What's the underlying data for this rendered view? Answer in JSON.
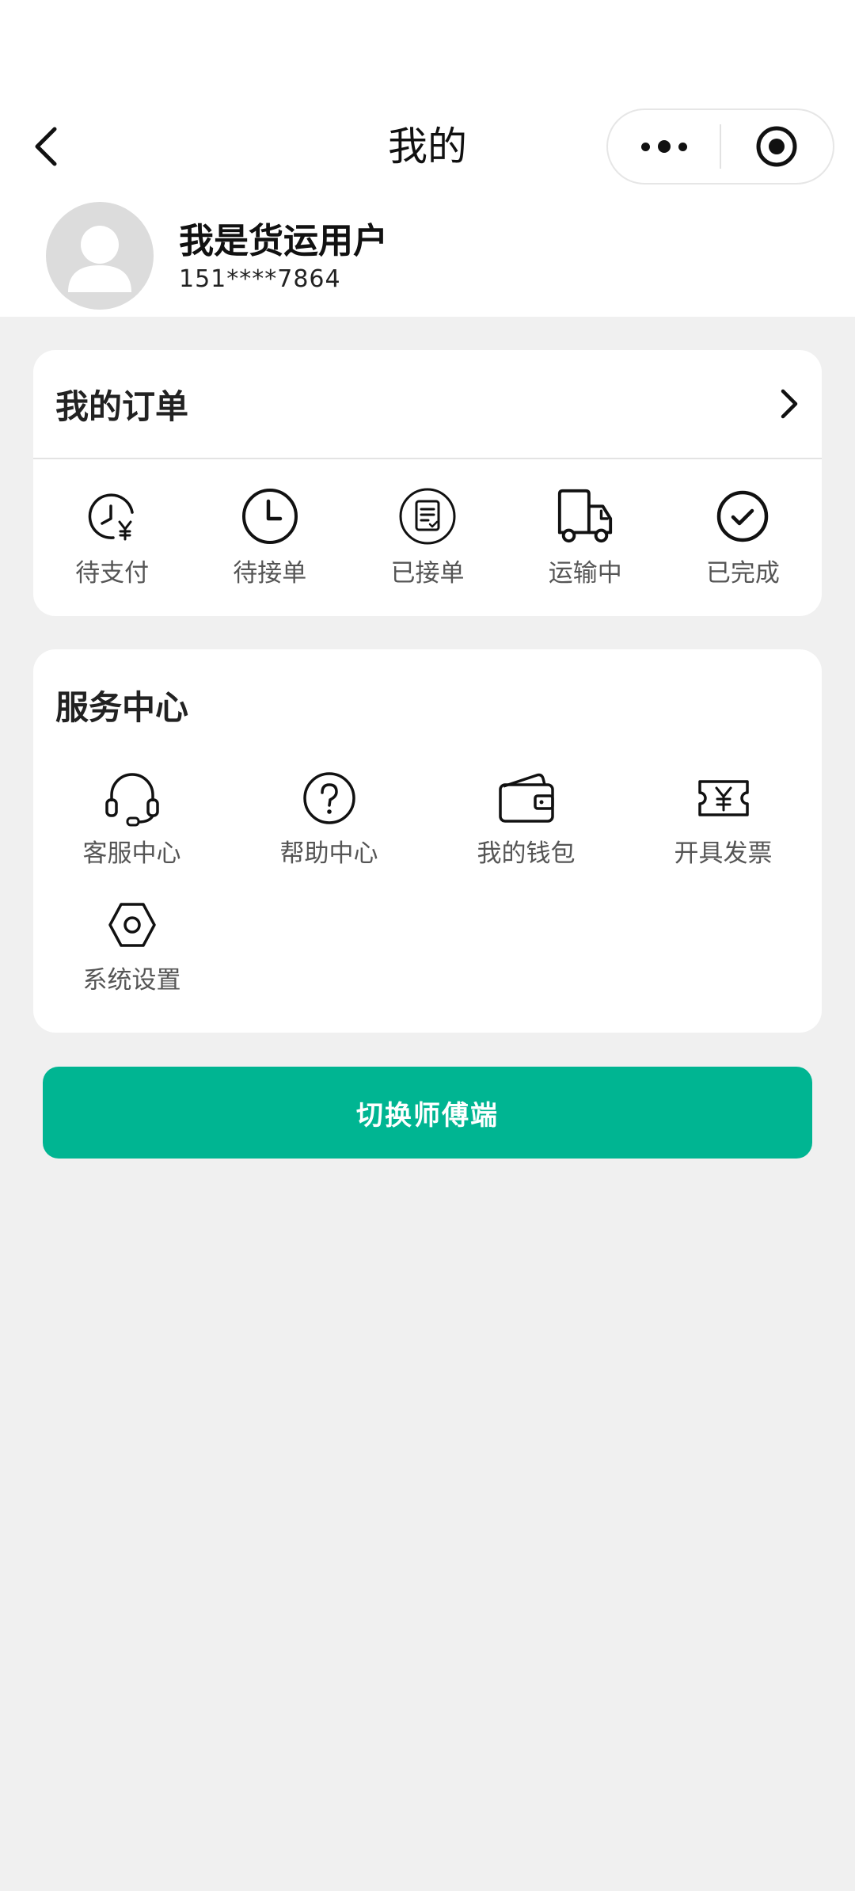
{
  "header": {
    "title": "我的",
    "back_icon": "chevron-left-icon",
    "menu_icon": "more-dots-icon",
    "close_icon": "target-circle-icon"
  },
  "user": {
    "name": "我是货运用户",
    "phone": "151****7864",
    "avatar_icon": "default-avatar-icon"
  },
  "orders": {
    "title": "我的订单",
    "chevron_icon": "chevron-right-icon",
    "items": [
      {
        "label": "待支付",
        "icon": "clock-yuan-icon"
      },
      {
        "label": "待接单",
        "icon": "clock-icon"
      },
      {
        "label": "已接单",
        "icon": "document-check-icon"
      },
      {
        "label": "运输中",
        "icon": "truck-icon"
      },
      {
        "label": "已完成",
        "icon": "check-circle-icon"
      }
    ]
  },
  "services": {
    "title": "服务中心",
    "items": [
      {
        "label": "客服中心",
        "icon": "headset-icon"
      },
      {
        "label": "帮助中心",
        "icon": "question-circle-icon"
      },
      {
        "label": "我的钱包",
        "icon": "wallet-icon"
      },
      {
        "label": "开具发票",
        "icon": "invoice-ticket-icon"
      },
      {
        "label": "系统设置",
        "icon": "hexagon-gear-icon"
      }
    ]
  },
  "switch_button": {
    "label": "切换师傅端",
    "color": "#00b592"
  },
  "colors": {
    "accent": "#00b592",
    "background": "#f0f0f0",
    "card": "#ffffff"
  }
}
